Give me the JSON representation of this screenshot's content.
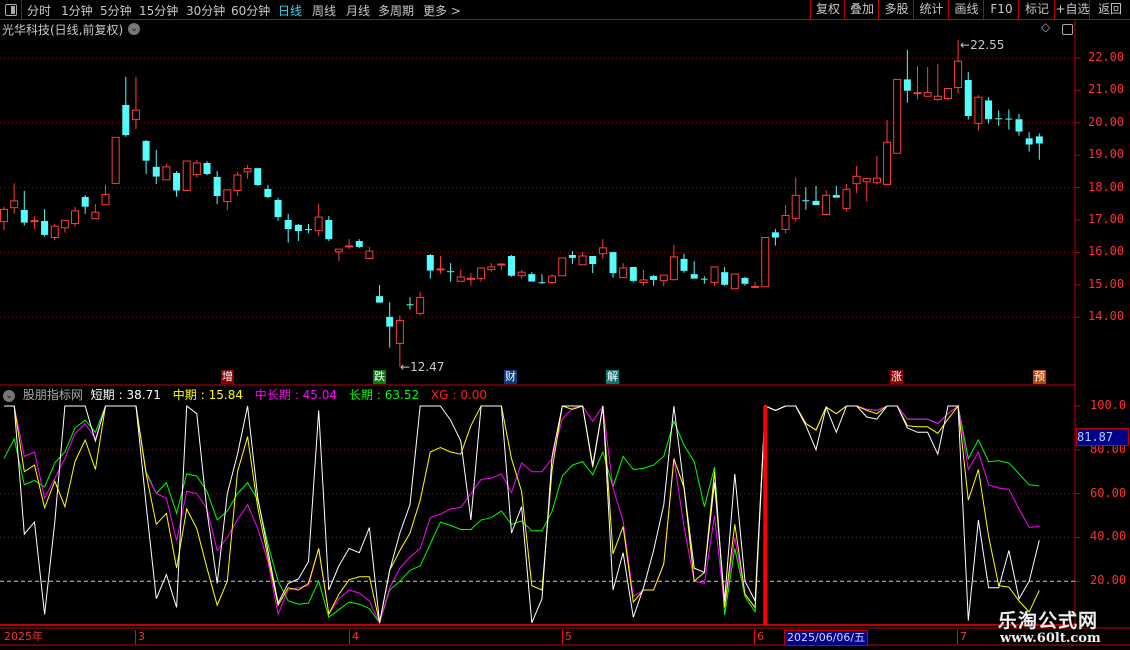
{
  "toolbar": {
    "periods": [
      {
        "label": "分时",
        "active": false
      },
      {
        "label": "1分钟",
        "active": false
      },
      {
        "label": "5分钟",
        "active": false
      },
      {
        "label": "15分钟",
        "active": false
      },
      {
        "label": "30分钟",
        "active": false
      },
      {
        "label": "60分钟",
        "active": false
      },
      {
        "label": "日线",
        "active": true
      },
      {
        "label": "周线",
        "active": false
      },
      {
        "label": "月线",
        "active": false
      },
      {
        "label": "多周期",
        "active": false
      },
      {
        "label": "更多 >",
        "active": false
      }
    ],
    "buttons": [
      "复权",
      "叠加",
      "多股",
      "统计",
      "画线",
      "F10",
      "标记",
      "+自选",
      "返回"
    ]
  },
  "stock_title": "光华科技(日线,前复权)",
  "price_axis": [
    "22.00",
    "21.00",
    "20.00",
    "19.00",
    "18.00",
    "17.00",
    "16.00",
    "15.00",
    "14.00"
  ],
  "price_annotations": {
    "high": "22.55",
    "low": "12.47"
  },
  "event_markers": [
    {
      "label": "增",
      "color": "#8b0000"
    },
    {
      "label": "跌",
      "color": "#00800a"
    },
    {
      "label": "财",
      "color": "#0a3a78"
    },
    {
      "label": "解",
      "color": "#0a7878"
    },
    {
      "label": "涨",
      "color": "#8b0000"
    },
    {
      "label": "预",
      "color": "#b04a10"
    }
  ],
  "indicator": {
    "source": "股朋指标网",
    "legend": [
      {
        "name": "短期",
        "value": "38.71",
        "color": "#ffffff"
      },
      {
        "name": "中期",
        "value": "15.84",
        "color": "#ffff00"
      },
      {
        "name": "中长期",
        "value": "45.04",
        "color": "#ff00ff"
      },
      {
        "name": "长期",
        "value": "63.52",
        "color": "#00ff00"
      },
      {
        "name": "XG",
        "value": "0.00",
        "color": "#ff2020"
      }
    ],
    "axis": [
      "100.0",
      "80.00",
      "60.00",
      "40.00",
      "20.00"
    ],
    "cursor_value": "81.87"
  },
  "date_axis": [
    "2025年",
    "3",
    "4",
    "5",
    "6",
    "2025/06/06/五",
    "7"
  ],
  "watermark": {
    "name": "乐淘公式网",
    "url": "www.60lt.com"
  },
  "colors": {
    "up": "#ff3c3c",
    "down": "#54fcfc",
    "grid": "#a00000",
    "axis": "#ff3030"
  },
  "chart_data": {
    "type": "candlestick",
    "ylim": [
      12,
      22.6
    ],
    "candles_ohlc": [
      [
        16.95,
        17.41,
        16.69,
        17.33
      ],
      [
        17.38,
        18.13,
        17.19,
        17.59
      ],
      [
        17.31,
        17.9,
        16.83,
        16.92
      ],
      [
        16.96,
        17.12,
        16.72,
        16.98
      ],
      [
        16.97,
        17.34,
        16.49,
        16.54
      ],
      [
        16.46,
        16.88,
        16.38,
        16.81
      ],
      [
        16.76,
        16.99,
        16.61,
        16.99
      ],
      [
        16.89,
        17.4,
        16.8,
        17.28
      ],
      [
        17.71,
        17.77,
        17.19,
        17.41
      ],
      [
        17.04,
        17.49,
        17.04,
        17.24
      ],
      [
        17.47,
        18.08,
        17.47,
        17.79
      ],
      [
        18.13,
        19.55,
        18.13,
        19.55
      ],
      [
        20.55,
        21.42,
        19.57,
        19.62
      ],
      [
        20.1,
        21.42,
        19.81,
        20.39
      ],
      [
        19.44,
        19.47,
        18.42,
        18.83
      ],
      [
        18.64,
        19.16,
        18.11,
        18.34
      ],
      [
        18.24,
        18.73,
        18.24,
        18.64
      ],
      [
        18.45,
        18.51,
        17.72,
        17.91
      ],
      [
        17.91,
        18.82,
        17.91,
        18.82
      ],
      [
        18.4,
        18.85,
        18.31,
        18.76
      ],
      [
        18.76,
        18.82,
        18.38,
        18.42
      ],
      [
        18.33,
        18.51,
        17.49,
        17.74
      ],
      [
        17.57,
        17.93,
        17.31,
        17.93
      ],
      [
        17.91,
        18.48,
        17.74,
        18.39
      ],
      [
        18.49,
        18.7,
        18.27,
        18.59
      ],
      [
        18.6,
        18.6,
        18.05,
        18.08
      ],
      [
        17.96,
        18.08,
        17.68,
        17.71
      ],
      [
        17.62,
        17.68,
        16.97,
        17.09
      ],
      [
        17.0,
        17.19,
        16.3,
        16.72
      ],
      [
        16.85,
        16.88,
        16.35,
        16.66
      ],
      [
        16.72,
        16.88,
        16.6,
        16.71
      ],
      [
        16.67,
        17.49,
        16.51,
        17.09
      ],
      [
        17.0,
        17.12,
        16.35,
        16.41
      ],
      [
        16.02,
        16.1,
        15.73,
        16.1
      ],
      [
        16.19,
        16.41,
        16.1,
        16.2
      ],
      [
        16.35,
        16.41,
        16.14,
        16.17
      ],
      [
        15.81,
        16.17,
        15.81,
        16.04
      ],
      [
        14.65,
        14.99,
        14.45,
        14.45
      ],
      [
        14.01,
        14.46,
        13.06,
        13.71
      ],
      [
        13.19,
        14.06,
        12.47,
        13.9
      ],
      [
        14.4,
        14.62,
        14.23,
        14.38
      ],
      [
        14.12,
        14.78,
        14.06,
        14.61
      ],
      [
        15.92,
        15.95,
        15.19,
        15.44
      ],
      [
        15.49,
        15.89,
        15.34,
        15.49
      ],
      [
        15.42,
        15.67,
        15.1,
        15.4
      ],
      [
        15.11,
        15.46,
        15.11,
        15.24
      ],
      [
        15.19,
        15.36,
        14.97,
        15.2
      ],
      [
        15.19,
        15.52,
        15.1,
        15.52
      ],
      [
        15.47,
        15.67,
        15.4,
        15.55
      ],
      [
        15.63,
        15.67,
        15.44,
        15.64
      ],
      [
        15.89,
        15.92,
        15.25,
        15.28
      ],
      [
        15.28,
        15.46,
        15.19,
        15.39
      ],
      [
        15.33,
        15.39,
        15.1,
        15.1
      ],
      [
        15.08,
        15.33,
        15.02,
        15.06
      ],
      [
        15.07,
        15.33,
        15.02,
        15.27
      ],
      [
        15.28,
        15.83,
        15.28,
        15.83
      ],
      [
        15.92,
        16.04,
        15.64,
        15.83
      ],
      [
        15.62,
        16.01,
        15.62,
        15.89
      ],
      [
        15.89,
        15.89,
        15.36,
        15.64
      ],
      [
        15.96,
        16.41,
        15.8,
        16.14
      ],
      [
        16.01,
        16.01,
        15.22,
        15.36
      ],
      [
        15.22,
        15.67,
        15.22,
        15.52
      ],
      [
        15.55,
        15.55,
        15.07,
        15.12
      ],
      [
        15.07,
        15.46,
        14.97,
        15.15
      ],
      [
        15.27,
        15.3,
        14.97,
        15.15
      ],
      [
        15.13,
        15.3,
        14.96,
        15.3
      ],
      [
        15.16,
        16.23,
        15.13,
        15.86
      ],
      [
        15.8,
        15.95,
        15.37,
        15.43
      ],
      [
        15.33,
        15.73,
        15.19,
        15.19
      ],
      [
        15.19,
        15.27,
        15.03,
        15.18
      ],
      [
        15.07,
        15.55,
        14.97,
        15.55
      ],
      [
        15.39,
        15.55,
        14.97,
        15.0
      ],
      [
        14.88,
        15.33,
        14.88,
        15.33
      ],
      [
        15.21,
        15.25,
        14.97,
        15.03
      ],
      [
        14.94,
        15.09,
        14.91,
        14.95
      ],
      [
        14.94,
        16.46,
        14.94,
        16.46
      ],
      [
        16.62,
        16.72,
        16.21,
        16.46
      ],
      [
        16.71,
        17.46,
        16.59,
        17.14
      ],
      [
        17.05,
        18.31,
        16.95,
        17.76
      ],
      [
        17.61,
        18.01,
        17.31,
        17.59
      ],
      [
        17.59,
        18.05,
        17.46,
        17.46
      ],
      [
        17.17,
        17.92,
        17.17,
        17.76
      ],
      [
        17.77,
        18.05,
        17.69,
        17.69
      ],
      [
        17.36,
        18.11,
        17.26,
        17.95
      ],
      [
        18.12,
        18.67,
        17.83,
        18.35
      ],
      [
        18.18,
        18.28,
        17.57,
        18.28
      ],
      [
        18.15,
        18.98,
        18.1,
        18.29
      ],
      [
        18.1,
        20.09,
        18.1,
        19.4
      ],
      [
        19.06,
        21.34,
        19.06,
        21.34
      ],
      [
        21.34,
        22.25,
        20.62,
        20.99
      ],
      [
        20.92,
        21.75,
        20.72,
        20.93
      ],
      [
        20.82,
        21.72,
        20.82,
        20.94
      ],
      [
        20.72,
        21.82,
        20.66,
        20.82
      ],
      [
        20.75,
        21.06,
        20.69,
        21.06
      ],
      [
        21.09,
        22.55,
        20.91,
        21.9
      ],
      [
        21.32,
        21.57,
        20.1,
        20.21
      ],
      [
        19.98,
        20.85,
        19.77,
        20.79
      ],
      [
        20.69,
        20.79,
        19.98,
        20.11
      ],
      [
        20.14,
        20.38,
        19.91,
        20.13
      ],
      [
        20.13,
        20.41,
        19.79,
        20.12
      ],
      [
        20.11,
        20.27,
        19.6,
        19.73
      ],
      [
        19.52,
        19.71,
        19.11,
        19.33
      ],
      [
        19.58,
        19.67,
        18.86,
        19.36
      ]
    ],
    "indicator_ylim": [
      0,
      100
    ],
    "indicator_reference_line": 20,
    "series": [
      {
        "name": "短期",
        "values": [
          100,
          100,
          41.5,
          47,
          4.8,
          47,
          100,
          100,
          100,
          84,
          100,
          100,
          100,
          100,
          55,
          12,
          23,
          8,
          100,
          96.5,
          52,
          19,
          60,
          78,
          100,
          58,
          34,
          10,
          19,
          21,
          29,
          98,
          16,
          27,
          35,
          33,
          44.5,
          1,
          25,
          42,
          55,
          100,
          100,
          100,
          93.5,
          84,
          48,
          100,
          100,
          100,
          42,
          54,
          1,
          12,
          77,
          100,
          100,
          100,
          73,
          100,
          16,
          33,
          3.5,
          17,
          34,
          55,
          100,
          62.6,
          26,
          24,
          65,
          11,
          69,
          20,
          11,
          100,
          98,
          100,
          100,
          91,
          80,
          99.5,
          88,
          100,
          100,
          95,
          94,
          100,
          100,
          90,
          88,
          88,
          78,
          100,
          100,
          2,
          48,
          17,
          17,
          34,
          12,
          20,
          38.71
        ]
      },
      {
        "name": "中期",
        "values": [
          100,
          100,
          70,
          73,
          53.5,
          65.6,
          54,
          74.6,
          84.5,
          71,
          100,
          100,
          100,
          100,
          69,
          46,
          51,
          26,
          53,
          44,
          26,
          9,
          20,
          70,
          86,
          53.5,
          31,
          9,
          17,
          16,
          19,
          35,
          5,
          14,
          20.7,
          22,
          22,
          1,
          25,
          34,
          42,
          57,
          79,
          81,
          79,
          78,
          91,
          100,
          100,
          100,
          76,
          61,
          18,
          16,
          71,
          100,
          98.5,
          100,
          72,
          100,
          32.5,
          45,
          10.5,
          16,
          16,
          28,
          76,
          62.6,
          20,
          24,
          70,
          8,
          46,
          14,
          8,
          100,
          98,
          100,
          100,
          92,
          89,
          99.5,
          96.5,
          100,
          100,
          98,
          96.5,
          100,
          100,
          91,
          90.5,
          90.5,
          87.5,
          94,
          100,
          57,
          71,
          40.5,
          18,
          17.3,
          11,
          6,
          15.84
        ]
      },
      {
        "name": "中长期",
        "values": [
          100,
          100,
          77,
          79,
          58,
          67,
          76,
          87.5,
          92,
          85,
          100,
          100,
          100,
          100,
          69,
          60,
          58,
          38.5,
          61,
          60,
          53,
          34,
          40,
          48,
          55,
          44,
          29,
          5,
          16,
          17,
          18,
          35,
          5,
          12,
          16,
          14.6,
          11,
          1,
          17,
          26,
          31,
          35,
          49,
          50.6,
          53,
          53.7,
          60,
          66.5,
          67,
          69,
          60.5,
          74,
          70,
          70,
          76,
          94,
          99,
          100,
          93,
          100,
          62.6,
          47.5,
          13,
          16,
          16,
          28,
          76,
          44.5,
          20,
          19,
          50,
          8,
          40,
          14,
          8,
          100,
          98,
          100,
          100,
          92,
          89,
          99.5,
          96.5,
          100,
          100,
          98.5,
          98,
          100,
          100,
          94,
          94,
          94,
          92,
          96.5,
          100,
          71,
          79,
          64,
          62.5,
          62,
          53,
          44.5,
          45.04
        ]
      },
      {
        "name": "长期",
        "values": [
          76,
          85,
          64,
          66,
          63,
          74,
          79,
          90,
          93.5,
          88,
          100,
          100,
          100,
          100,
          70,
          60,
          65,
          51,
          69,
          68,
          61,
          48,
          52,
          60,
          65,
          57,
          37,
          20,
          11,
          9.5,
          10,
          20,
          3.5,
          7,
          10.5,
          9.5,
          7.5,
          1,
          16,
          20,
          25,
          27,
          37,
          47,
          45.5,
          43.6,
          43.6,
          48,
          49,
          52,
          46,
          47.5,
          43,
          43,
          52,
          68,
          73,
          74.6,
          68.6,
          79,
          63,
          77,
          71,
          71.5,
          73,
          77,
          93,
          82,
          74.6,
          54,
          72,
          4.5,
          35,
          13,
          6,
          100,
          98,
          100,
          100,
          92,
          89,
          99.5,
          96.5,
          100,
          100,
          98.5,
          98,
          100,
          100,
          94,
          94,
          94,
          92,
          96.5,
          100,
          76,
          84.5,
          74.6,
          75,
          74,
          69,
          64,
          63.52
        ]
      },
      {
        "name": "XG",
        "signal_index": 75,
        "values_note_free": true
      }
    ]
  }
}
